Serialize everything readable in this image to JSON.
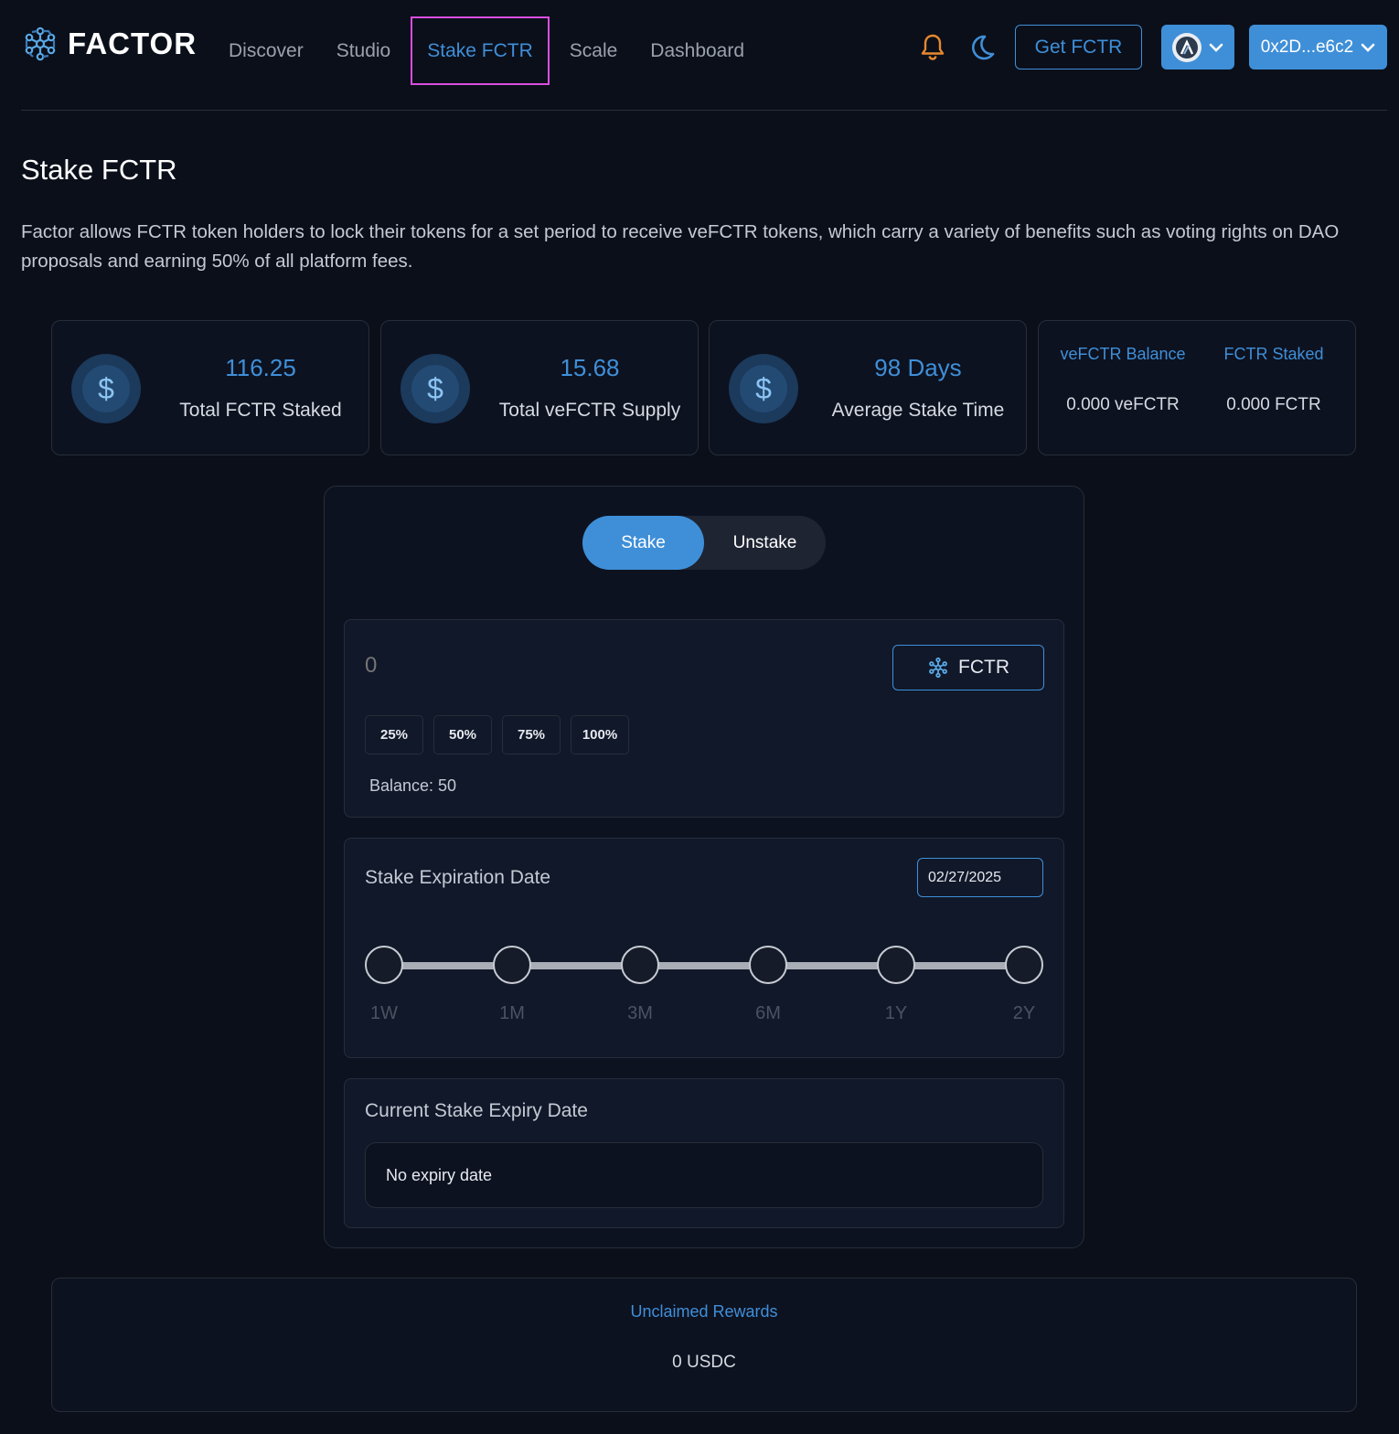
{
  "header": {
    "logo_text": "FACTOR",
    "nav": [
      "Discover",
      "Studio",
      "Stake FCTR",
      "Scale",
      "Dashboard"
    ],
    "active_nav": "Stake FCTR",
    "get_button": "Get FCTR",
    "wallet": "0x2D...e6c2",
    "icons": [
      "bell-icon",
      "moon-icon",
      "chain-icon",
      "chevron-down-icon"
    ]
  },
  "page": {
    "title": "Stake FCTR",
    "intro": "Factor allows FCTR token holders to lock their tokens for a set period to receive veFCTR tokens, which carry a variety of benefits such as voting rights on DAO proposals and earning 50% of all platform fees."
  },
  "stats": [
    {
      "value": "116.25",
      "label": "Total FCTR Staked"
    },
    {
      "value": "15.68",
      "label": "Total veFCTR Supply"
    },
    {
      "value": "98 Days",
      "label": "Average Stake Time"
    }
  ],
  "balances": {
    "vefctr_title": "veFCTR Balance",
    "vefctr_value": "0.000 veFCTR",
    "staked_title": "FCTR Staked",
    "staked_value": "0.000 FCTR"
  },
  "stake_panel": {
    "toggle": {
      "stake": "Stake",
      "unstake": "Unstake",
      "selected": "Stake"
    },
    "amount_placeholder": "0",
    "token": "FCTR",
    "percent_buttons": [
      "25%",
      "50%",
      "75%",
      "100%"
    ],
    "balance": "Balance: 50",
    "expiration_title": "Stake Expiration Date",
    "expiration_date": "02/27/2025",
    "durations": [
      "1W",
      "1M",
      "3M",
      "6M",
      "1Y",
      "2Y"
    ],
    "current_expiry_title": "Current Stake Expiry Date",
    "current_expiry_value": "No expiry date"
  },
  "rewards": {
    "title": "Unclaimed Rewards",
    "value": "0 USDC"
  },
  "colors": {
    "background": "#0b0f1a",
    "accent": "#3f8fd8",
    "bell": "#e8892e",
    "active_tab_outline": "#d94ee0"
  }
}
